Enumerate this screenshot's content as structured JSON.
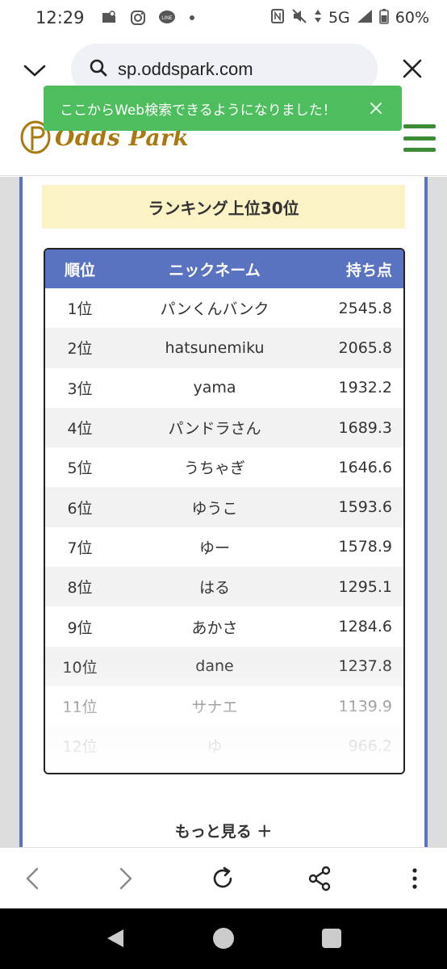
{
  "status_bar": {
    "time": "12:29",
    "network": "5G",
    "battery": "60%",
    "icons": [
      "notification-app-icon",
      "instagram-icon",
      "line-icon",
      "dot-icon",
      "nfc-icon",
      "mute-icon",
      "data-arrows-icon",
      "signal-icon",
      "battery-icon"
    ]
  },
  "browser": {
    "url": "sp.oddspark.com"
  },
  "toast": {
    "message": "ここからWeb検索できるようになりました！"
  },
  "site": {
    "logo_text": "Odds Park"
  },
  "ranking": {
    "title": "ランキング上位30位",
    "headers": {
      "rank": "順位",
      "nickname": "ニックネーム",
      "points": "持ち点"
    },
    "rows": [
      {
        "rank": "1位",
        "name": "パンくんバンク",
        "points": "2545.8"
      },
      {
        "rank": "2位",
        "name": "hatsunemiku",
        "points": "2065.8"
      },
      {
        "rank": "3位",
        "name": "yama",
        "points": "1932.2"
      },
      {
        "rank": "4位",
        "name": "パンドラさん",
        "points": "1689.3"
      },
      {
        "rank": "5位",
        "name": "うちゃぎ",
        "points": "1646.6"
      },
      {
        "rank": "6位",
        "name": "ゆうこ",
        "points": "1593.6"
      },
      {
        "rank": "7位",
        "name": "ゆー",
        "points": "1578.9"
      },
      {
        "rank": "8位",
        "name": "はる",
        "points": "1295.1"
      },
      {
        "rank": "9位",
        "name": "あかさ",
        "points": "1284.6"
      },
      {
        "rank": "10位",
        "name": "dane",
        "points": "1237.8"
      },
      {
        "rank": "11位",
        "name": "サナエ",
        "points": "1139.9"
      },
      {
        "rank": "12位",
        "name": "ゆ",
        "points": "966.2"
      }
    ],
    "more_label": "もっと見る ＋"
  },
  "colors": {
    "accent_blue": "#5a73c0",
    "toast_green": "#4dbd5e",
    "menu_green": "#3c8c36",
    "title_bg": "#fbf3c5",
    "logo_gold": "#a8790e"
  }
}
